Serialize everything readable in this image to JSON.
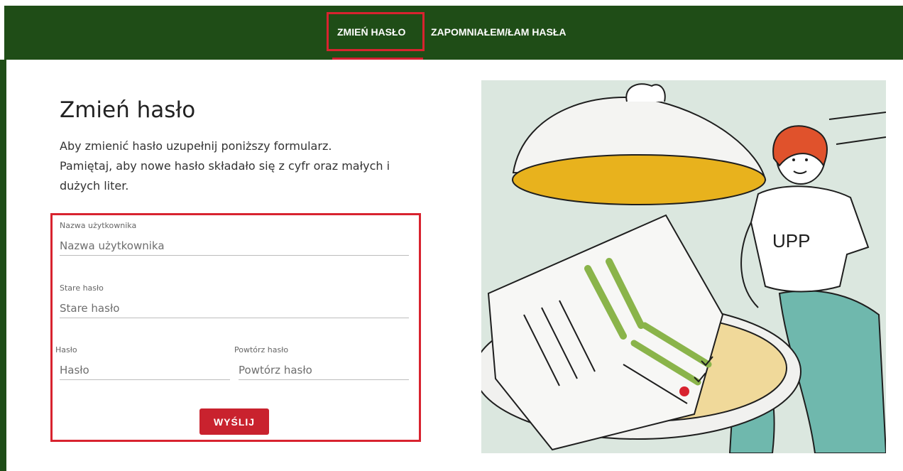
{
  "nav": {
    "tab_change": "ZMIEŃ HASŁO",
    "tab_forgot": "ZAPOMNIAŁEM/ŁAM HASŁA"
  },
  "page": {
    "title": "Zmień hasło",
    "intro_line1": "Aby zmienić hasło uzupełnij poniższy formularz.",
    "intro_line2": "Pamiętaj, aby nowe hasło składało się z cyfr oraz małych i",
    "intro_line3": "dużych liter."
  },
  "form": {
    "username": {
      "label": "Nazwa użytkownika",
      "placeholder": "Nazwa użytkownika",
      "value": ""
    },
    "old_password": {
      "label": "Stare hasło",
      "placeholder": "Stare hasło",
      "value": ""
    },
    "password": {
      "label": "Hasło",
      "placeholder": "Hasło",
      "value": ""
    },
    "repeat_password": {
      "label": "Powtórz hasło",
      "placeholder": "Powtórz hasło",
      "value": ""
    },
    "submit_label": "WYŚLIJ"
  },
  "illustration": {
    "shirt_text": "UPP"
  },
  "colors": {
    "nav_green": "#1f4d17",
    "accent_red": "#c9222e",
    "highlight_red": "#d8232f",
    "illustration_bg": "#dbe7df"
  }
}
